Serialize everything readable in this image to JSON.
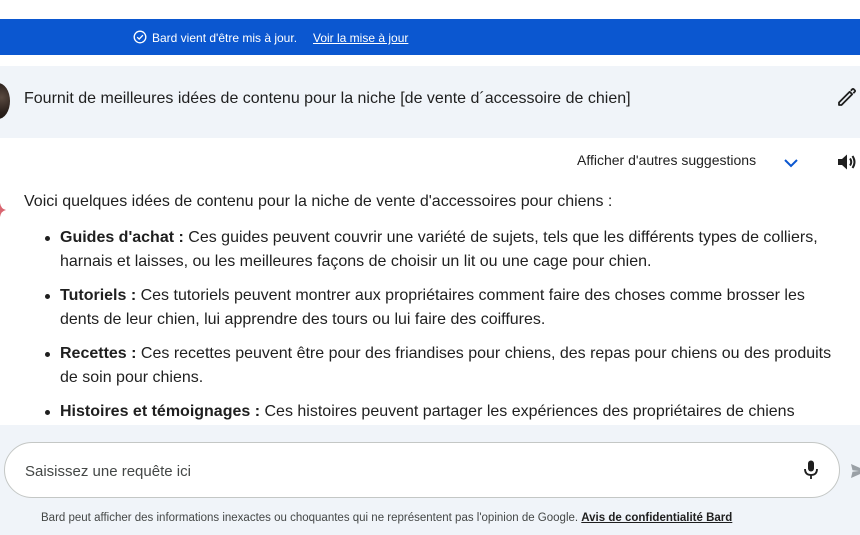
{
  "banner": {
    "message": "Bard vient d'être mis à jour.",
    "link_label": "Voir la mise à jour",
    "background": "#0b57d0",
    "icon": "check-circle-icon"
  },
  "prompt": {
    "text": "Fournit de meilleures idées de contenu pour la niche [de vente d´accessoire de chien]",
    "avatar_icon": "user-avatar",
    "edit_icon": "pencil-icon"
  },
  "response_header": {
    "suggestions_label": "Afficher d'autres suggestions",
    "chevron_icon": "chevron-down-icon",
    "speaker_icon": "volume-icon"
  },
  "response": {
    "intro": "Voici quelques idées de contenu pour la niche de vente d'accessoires pour chiens :",
    "items": [
      {
        "title": "Guides d'achat :",
        "text": " Ces guides peuvent couvrir une variété de sujets, tels que les différents types de colliers, harnais et laisses, ou les meilleures façons de choisir un lit ou une cage pour chien."
      },
      {
        "title": "Tutoriels :",
        "text": " Ces tutoriels peuvent montrer aux propriétaires comment faire des choses comme brosser les dents de leur chien, lui apprendre des tours ou lui faire des coiffures."
      },
      {
        "title": "Recettes :",
        "text": " Ces recettes peuvent être pour des friandises pour chiens, des repas pour chiens ou des produits de soin pour chiens."
      },
      {
        "title": "Histoires et témoignages :",
        "text": " Ces histoires peuvent partager les expériences des propriétaires de chiens"
      }
    ]
  },
  "input": {
    "placeholder": "Saisissez une requête ici",
    "mic_icon": "microphone-icon",
    "send_icon": "send-icon"
  },
  "footer": {
    "disclaimer": "Bard peut afficher des informations inexactes ou choquantes qui ne représentent pas l'opinion de Google. ",
    "privacy_link": "Avis de confidentialité Bard"
  },
  "colors": {
    "accent": "#0b57d0",
    "surface": "#f0f4f9",
    "text": "#1f1f1f"
  }
}
